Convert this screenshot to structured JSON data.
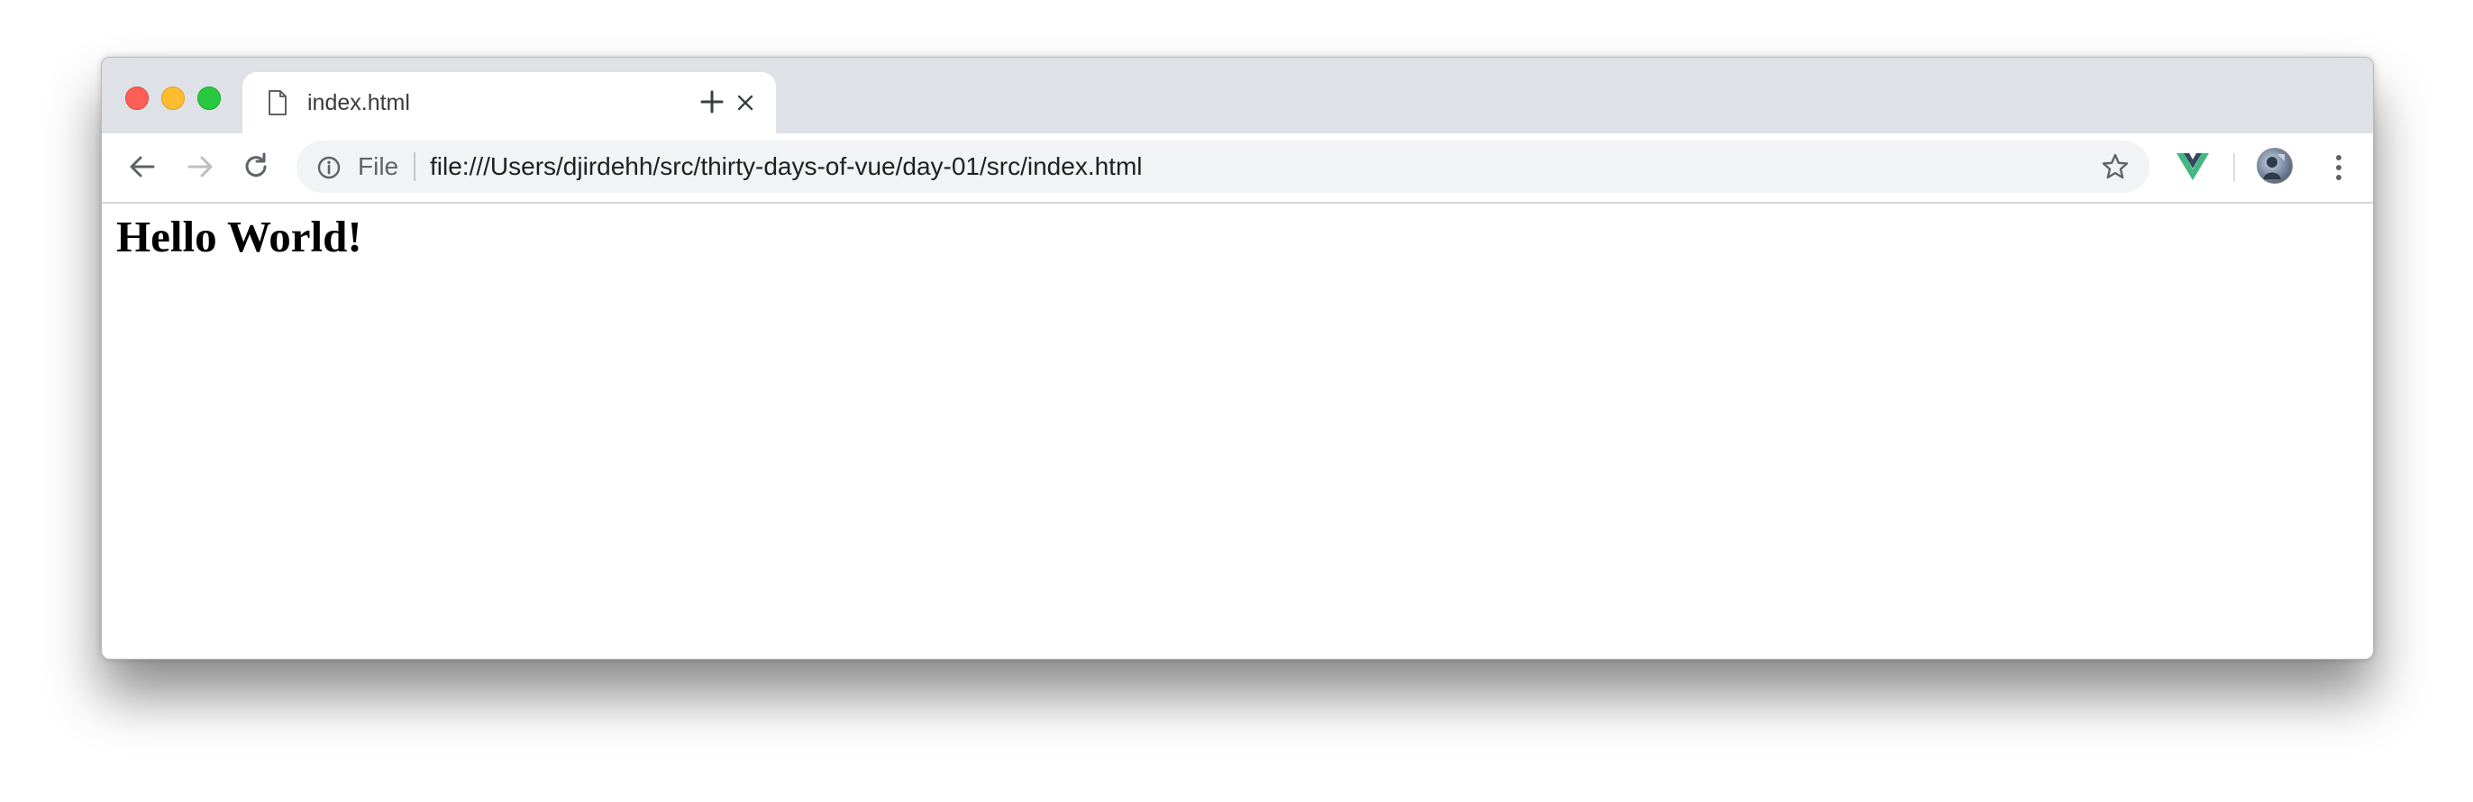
{
  "tab": {
    "title": "index.html",
    "icon": "file-icon"
  },
  "toolbar": {
    "back_icon": "arrow-back-icon",
    "forward_icon": "arrow-forward-icon",
    "reload_icon": "reload-icon",
    "omnibox": {
      "scheme_label": "File",
      "url": "file:///Users/djirdehh/src/thirty-days-of-vue/day-01/src/index.html",
      "info_icon": "info-icon",
      "bookmark_icon": "star-icon"
    },
    "extension_icon": "vue-devtools-icon",
    "avatar_icon": "profile-avatar",
    "menu_icon": "more-vertical-icon"
  },
  "page": {
    "heading": "Hello World!"
  },
  "colors": {
    "tabstrip": "#dee1e6",
    "omnibox": "#f1f3f4",
    "close": "#fe5f57",
    "minimize": "#febc2e",
    "maximize": "#28c840",
    "vue_green": "#41b883",
    "vue_dark": "#35495e"
  }
}
